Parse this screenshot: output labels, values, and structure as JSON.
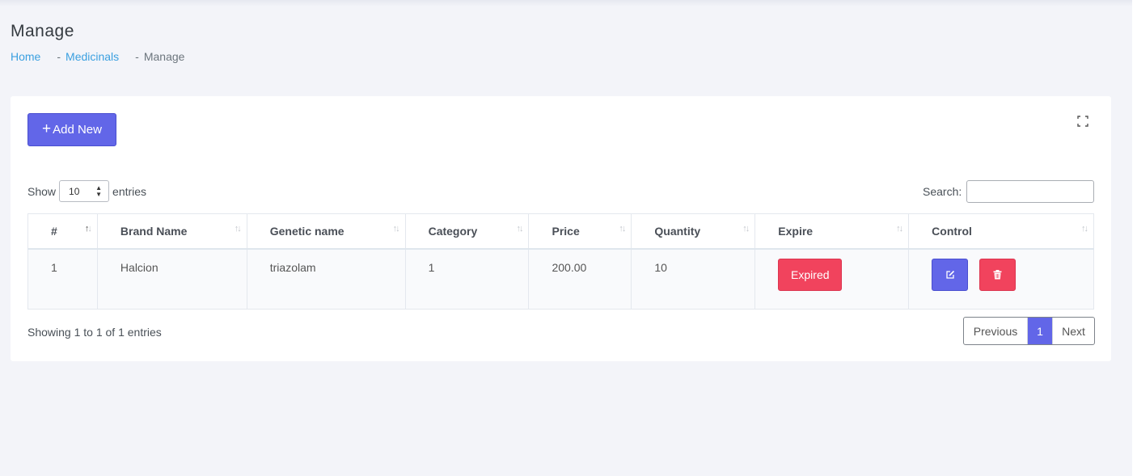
{
  "header": {
    "title": "Manage",
    "breadcrumb": [
      "Home",
      "Medicinals",
      "Manage"
    ]
  },
  "toolbar": {
    "add_label": "Add New",
    "add_icon": "plus-icon",
    "fullscreen_icon": "fullscreen-icon"
  },
  "controls": {
    "show_label": "Show",
    "entries_value": "10",
    "entries_label": "entries",
    "search_label": "Search:",
    "search_value": ""
  },
  "table": {
    "columns": [
      "#",
      "Brand Name",
      "Genetic name",
      "Category",
      "Price",
      "Quantity",
      "Expire",
      "Control"
    ],
    "sorted_column": "#",
    "rows": [
      {
        "num": "1",
        "brand": "Halcion",
        "generic": "triazolam",
        "category": "1",
        "price": "200.00",
        "quantity": "10",
        "expire": "Expired"
      }
    ]
  },
  "footer": {
    "info": "Showing 1 to 1 of 1 entries",
    "prev": "Previous",
    "current_page": "1",
    "next": "Next"
  },
  "colors": {
    "primary": "#6266e8",
    "danger": "#f1435d",
    "link": "#3ba0e0",
    "background": "#f3f4f9"
  }
}
